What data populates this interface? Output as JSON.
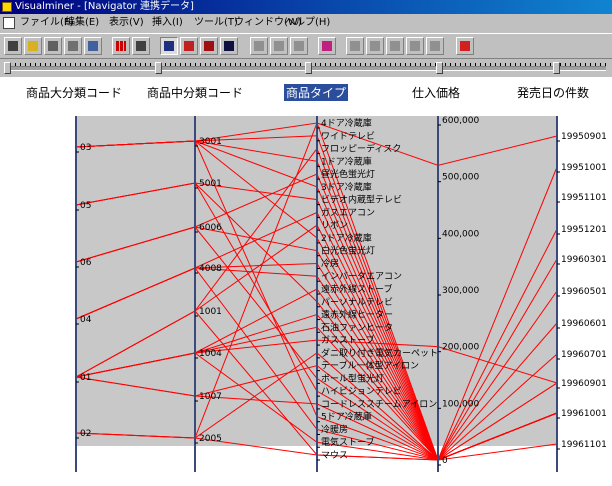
{
  "window": {
    "title": "Visualminer - [Navigator 連携データ]"
  },
  "menu": [
    "ファイル(F)",
    "編集(E)",
    "表示(V)",
    "挿入(I)",
    "ツール(T)",
    "ウィンドウ(W)",
    "ヘルプ(H)"
  ],
  "colors": {
    "line": "#ff0000",
    "axis": "#3a4a7a",
    "plot_bg": "#c8c8c8",
    "selected_header": "#2a4d9c"
  },
  "axes": [
    {
      "name": "商品大分類コード",
      "selected": false,
      "labels": [
        "03",
        "05",
        "06",
        "04",
        "01",
        "02"
      ]
    },
    {
      "name": "商品中分類コード",
      "selected": false,
      "labels": [
        "3001",
        "5001",
        "6006",
        "4008",
        "1001",
        "1004",
        "1007",
        "2005"
      ]
    },
    {
      "name": "商品タイプ",
      "selected": true,
      "labels": [
        "4ドア冷蔵庫",
        "ワイドテレビ",
        "フロッピーディスク",
        "1ドア冷蔵庫",
        "昼光色蛍光灯",
        "3ドア冷蔵庫",
        "ビデオ内蔵型テレビ",
        "ガスエアコン",
        "リボン",
        "2ドア冷蔵庫",
        "白光色蛍光灯",
        "冷房",
        "インバータエアコン",
        "遠赤外線ストーブ",
        "パーソナルテレビ",
        "遠赤外線ヒーター",
        "石油ファンヒータ",
        "ガスストーブ",
        "ダニ取り付き電気カーペット",
        "テーブル一体型アイロン",
        "ボール型蛍光灯",
        "ハイビジョンテレビ",
        "コードレススチームアイロン",
        "5ドア冷蔵庫",
        "冷暖房",
        "電気ストーブ",
        "マウス"
      ]
    },
    {
      "name": "仕入価格",
      "selected": false,
      "labels": [
        "600,000",
        "500,000",
        "400,000",
        "300,000",
        "200,000",
        "100,000",
        "0"
      ]
    },
    {
      "name": "発売日の件数",
      "selected": false,
      "labels": [
        "19950901",
        "19951001",
        "19951101",
        "19951201",
        "19960301",
        "19960501",
        "19960601",
        "19960701",
        "19960901",
        "19961001",
        "19961101"
      ]
    }
  ],
  "chart_data": {
    "type": "parallel-coordinates",
    "dimensions": [
      "商品大分類コード",
      "商品中分類コード",
      "商品タイプ",
      "仕入価格",
      "発売日の件数"
    ],
    "price_range": [
      0,
      600000
    ],
    "records": [
      [
        "03",
        "3001",
        "4ドア冷蔵庫",
        0,
        "19961001"
      ],
      [
        "03",
        "3001",
        "ワイドテレビ",
        0,
        "19961001"
      ],
      [
        "03",
        "3001",
        "1ドア冷蔵庫",
        0,
        "19961001"
      ],
      [
        "03",
        "3001",
        "3ドア冷蔵庫",
        0,
        "19960901"
      ],
      [
        "03",
        "3001",
        "2ドア冷蔵庫",
        0,
        "19961001"
      ],
      [
        "03",
        "3001",
        "5ドア冷蔵庫",
        0,
        "19961001"
      ],
      [
        "05",
        "5001",
        "ビデオ内蔵型テレビ",
        0,
        "19961001"
      ],
      [
        "05",
        "5001",
        "パーソナルテレビ",
        0,
        "19961001"
      ],
      [
        "05",
        "5001",
        "ハイビジョンテレビ",
        0,
        "19960301"
      ],
      [
        "06",
        "6006",
        "昼光色蛍光灯",
        0,
        "19961001"
      ],
      [
        "06",
        "6006",
        "白光色蛍光灯",
        0,
        "19961001"
      ],
      [
        "06",
        "6006",
        "ボール型蛍光灯",
        0,
        "19961001"
      ],
      [
        "04",
        "4008",
        "冷房",
        0,
        "19961001"
      ],
      [
        "04",
        "4008",
        "インバータエアコン",
        0,
        "19961001"
      ],
      [
        "04",
        "4008",
        "冷暖房",
        0,
        "19961001"
      ],
      [
        "04",
        "4008",
        "ガスエアコン",
        0,
        "19961001"
      ],
      [
        "01",
        "1001",
        "フロッピーディスク",
        0,
        "19960901"
      ],
      [
        "01",
        "1001",
        "リボン",
        0,
        "19951201"
      ],
      [
        "01",
        "1001",
        "マウス",
        0,
        "19961101"
      ],
      [
        "01",
        "1004",
        "遠赤外線ストーブ",
        0,
        "19960701"
      ],
      [
        "01",
        "1004",
        "遠赤外線ヒーター",
        0,
        "19960601"
      ],
      [
        "01",
        "1004",
        "石油ファンヒータ",
        0,
        "19961001"
      ],
      [
        "01",
        "1004",
        "ガスストーブ",
        200000,
        "19960901"
      ],
      [
        "01",
        "1004",
        "電気ストーブ",
        0,
        "19961001"
      ],
      [
        "01",
        "1007",
        "テーブル一体型アイロン",
        0,
        "19961001"
      ],
      [
        "01",
        "1007",
        "コードレススチームアイロン",
        0,
        "19961001"
      ],
      [
        "02",
        "2005",
        "ダニ取り付き電気カーペット",
        0,
        "19951001"
      ],
      [
        "02",
        "2005",
        "4ドア冷蔵庫",
        520000,
        "19950901"
      ],
      [
        "02",
        "2005",
        "マウス",
        0,
        "19960501"
      ]
    ]
  }
}
